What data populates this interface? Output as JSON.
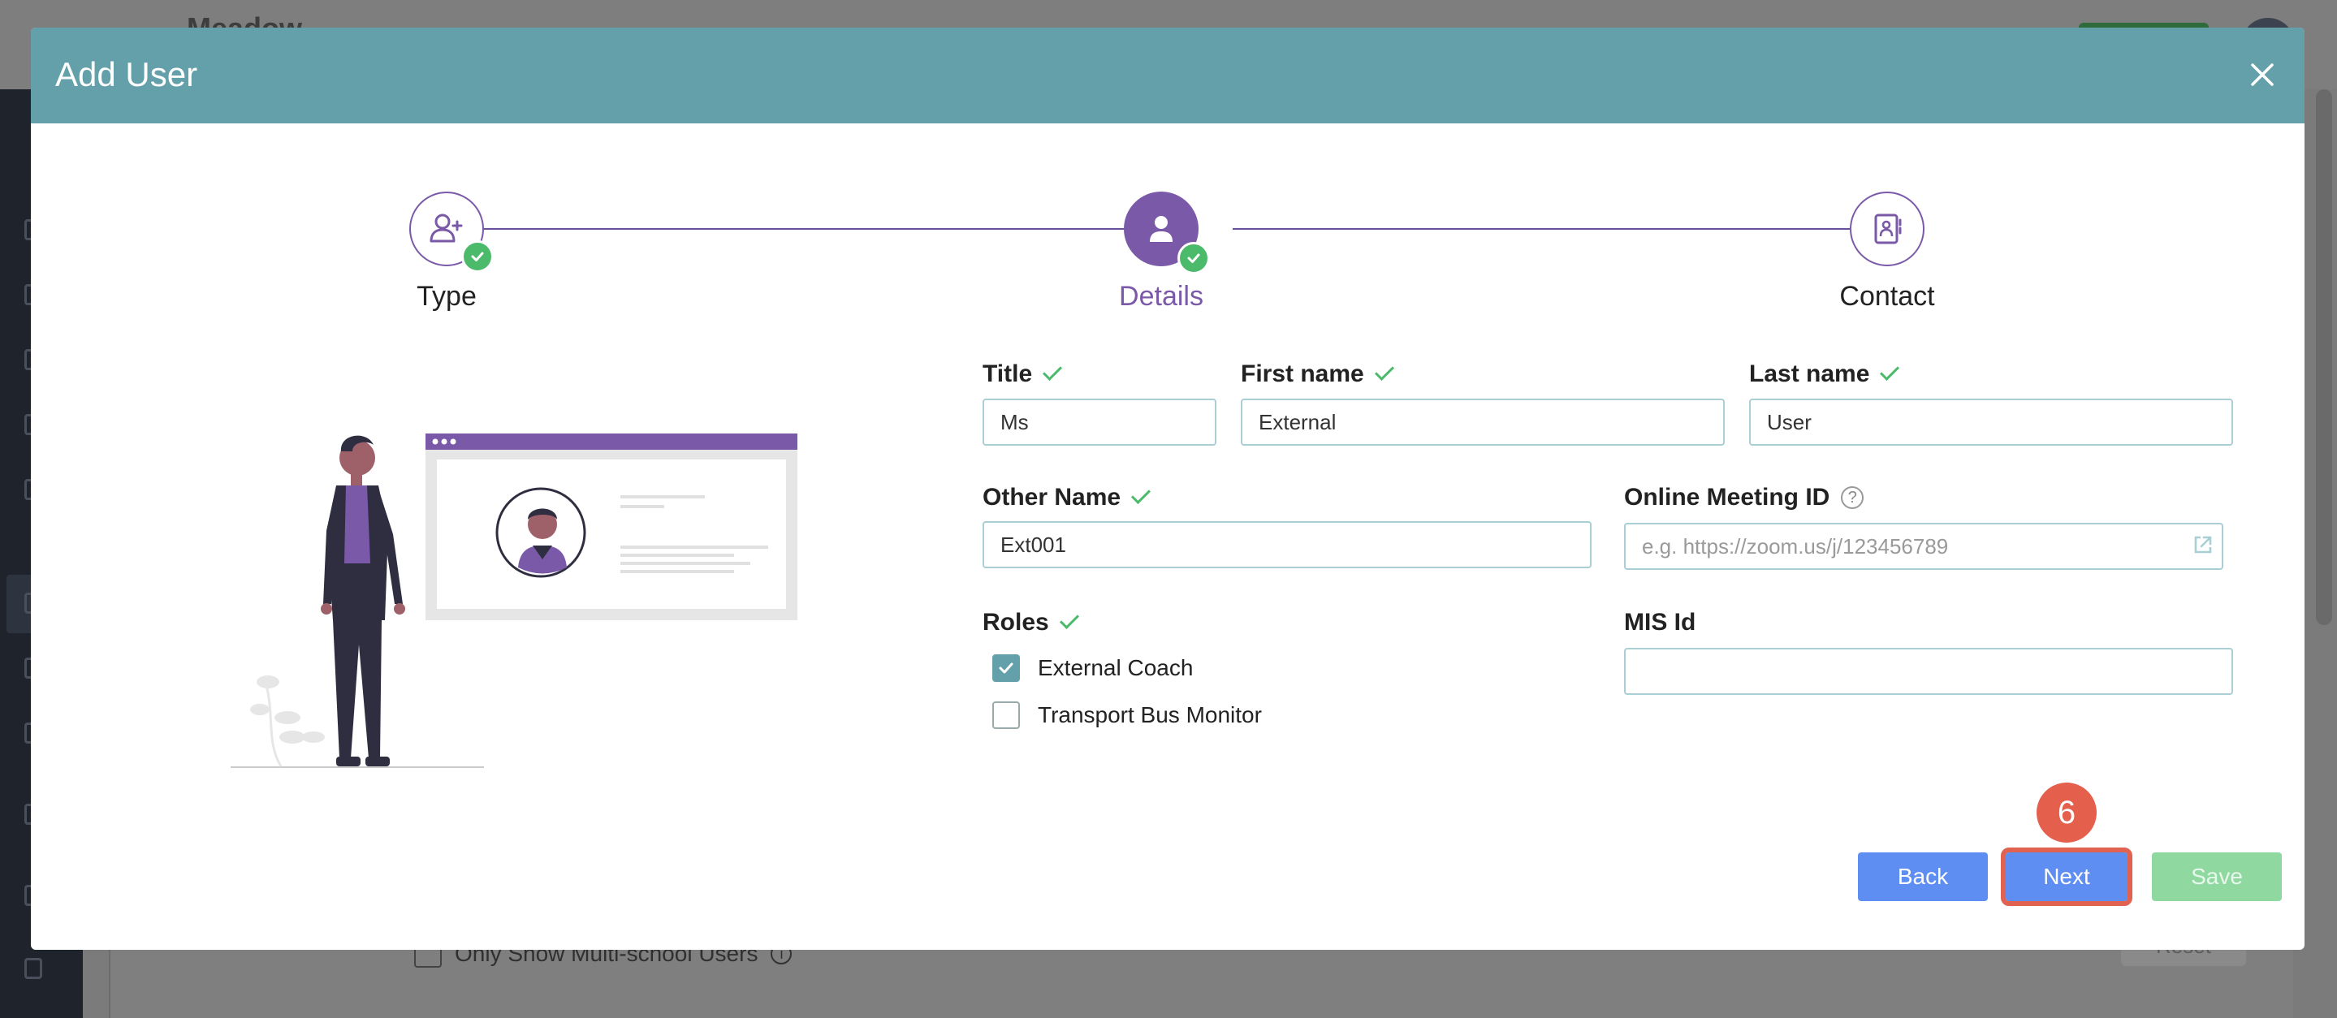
{
  "background": {
    "logo": "Meadow",
    "filter_label": "Only Show Multi-school Users",
    "reset_label": "Reset"
  },
  "modal": {
    "title": "Add User",
    "close_icon": "close-icon"
  },
  "stepper": {
    "steps": [
      {
        "label": "Type",
        "icon": "user-plus-icon",
        "state": "completed"
      },
      {
        "label": "Details",
        "icon": "user-icon",
        "state": "active-completed"
      },
      {
        "label": "Contact",
        "icon": "contact-book-icon",
        "state": "pending"
      }
    ]
  },
  "form": {
    "title": {
      "label": "Title",
      "value": "Ms"
    },
    "first_name": {
      "label": "First name",
      "value": "External"
    },
    "last_name": {
      "label": "Last name",
      "value": "User"
    },
    "other_name": {
      "label": "Other Name",
      "value": "Ext001"
    },
    "online_meeting_id": {
      "label": "Online Meeting ID",
      "value": "",
      "placeholder": "e.g. https://zoom.us/j/123456789",
      "help": "?"
    },
    "mis_id": {
      "label": "MIS Id",
      "value": ""
    },
    "roles": {
      "label": "Roles",
      "options": [
        {
          "label": "External Coach",
          "checked": true
        },
        {
          "label": "Transport Bus Monitor",
          "checked": false
        }
      ]
    }
  },
  "actions": {
    "back_label": "Back",
    "next_label": "Next",
    "save_label": "Save"
  },
  "annotation": {
    "step_number": "6"
  },
  "colors": {
    "header": "#64a0a9",
    "accent_purple": "#7a5aa8",
    "success_green": "#4cba6b",
    "primary_blue": "#5e8ef2",
    "highlight_red": "#e06351"
  }
}
